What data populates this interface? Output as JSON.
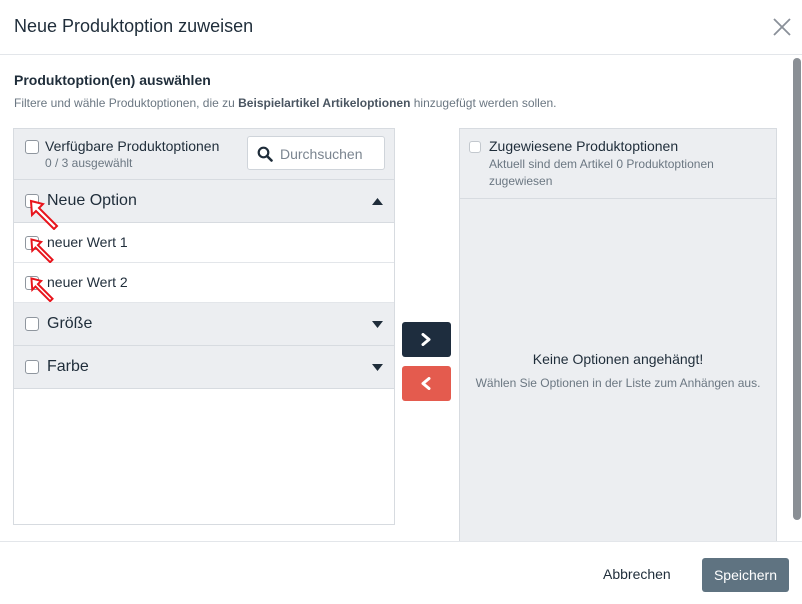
{
  "modal": {
    "title": "Neue Produktoption zuweisen",
    "close_icon": "close-icon"
  },
  "section": {
    "title": "Produktoption(en) auswählen",
    "desc_prefix": "Filtere und wähle Produktoptionen, die zu ",
    "desc_bold": "Beispielartikel Artikeloptionen",
    "desc_suffix": " hinzugefügt werden sollen."
  },
  "available": {
    "title": "Verfügbare Produktoptionen",
    "count": "0 / 3 ausgewählt",
    "search_placeholder": "Durchsuchen",
    "search_icon": "search-icon",
    "groups": [
      {
        "label": "Neue Option",
        "expanded": true,
        "checked": false,
        "values": [
          {
            "label": "neuer Wert 1",
            "checked": false
          },
          {
            "label": "neuer Wert 2",
            "checked": false
          }
        ]
      },
      {
        "label": "Größe",
        "expanded": false,
        "checked": false
      },
      {
        "label": "Farbe",
        "expanded": false,
        "checked": false
      }
    ]
  },
  "transfer": {
    "add_icon": "chevron-right-icon",
    "remove_icon": "chevron-left-icon",
    "add_color": "#1e2d3e",
    "remove_color": "#e45b4e"
  },
  "assigned": {
    "title": "Zugewiesene Produktoptionen",
    "subtitle": "Aktuell sind dem Artikel 0 Produktoptionen zugewiesen",
    "empty_title": "Keine Optionen angehängt!",
    "empty_hint": "Wählen Sie Optionen in der Liste zum Anhängen aus."
  },
  "footer": {
    "cancel_label": "Abbrechen",
    "save_label": "Speichern",
    "save_color": "#5f7381"
  },
  "annotations": {
    "arrow_color": "#e8141c"
  }
}
